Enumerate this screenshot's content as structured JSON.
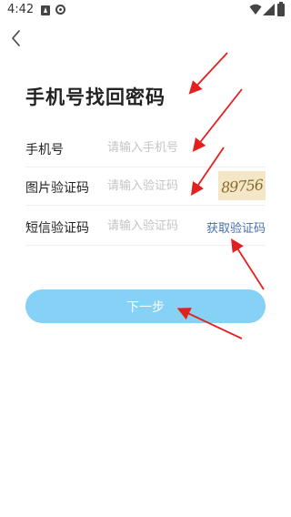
{
  "status_bar": {
    "time": "4:42",
    "icons": [
      "a-notification-icon",
      "sync-icon",
      "wifi-icon",
      "signal-icon",
      "battery-icon"
    ]
  },
  "header": {
    "back_icon": "chevron-left-icon",
    "title": "手机号找回密码"
  },
  "form": {
    "phone": {
      "label": "手机号",
      "value": "",
      "placeholder": "请输入手机号"
    },
    "captcha": {
      "label": "图片验证码",
      "value": "",
      "placeholder": "请输入验证码",
      "image_text": "89756"
    },
    "sms": {
      "label": "短信验证码",
      "value": "",
      "placeholder": "请输入验证码",
      "get_code_label": "获取验证码"
    }
  },
  "actions": {
    "next_label": "下一步"
  },
  "colors": {
    "primary_button": "#86d1f6",
    "link": "#4a6fa8",
    "placeholder": "#c4c4c4",
    "annotation_arrow": "#e32020"
  }
}
